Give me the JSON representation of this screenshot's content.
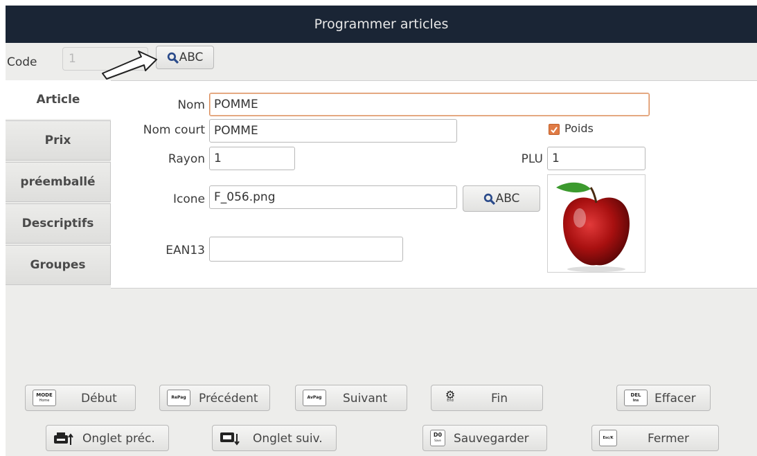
{
  "window": {
    "title": "Programmer articles"
  },
  "code": {
    "label": "Code",
    "value": "1",
    "search_label": "ABC"
  },
  "tabs": [
    {
      "label": "Article",
      "active": true
    },
    {
      "label": "Prix"
    },
    {
      "label": "préemballé"
    },
    {
      "label": "Descriptifs"
    },
    {
      "label": "Groupes"
    }
  ],
  "form": {
    "nom_label": "Nom",
    "nom_value": "POMME",
    "nom_court_label": "Nom court",
    "nom_court_value": "POMME",
    "poids_label": "Poids",
    "poids_checked": true,
    "rayon_label": "Rayon",
    "rayon_value": "1",
    "plu_label": "PLU",
    "plu_value": "1",
    "icone_label": "Icone",
    "icone_value": "F_056.png",
    "icone_search_label": "ABC",
    "ean13_label": "EAN13",
    "ean13_value": ""
  },
  "buttons": {
    "debut": {
      "label": "Début",
      "key_top": "MODE",
      "key_bottom": "Home"
    },
    "precedent": {
      "label": "Précédent",
      "key_top": "RePag"
    },
    "suivant": {
      "label": "Suivant",
      "key_top": "AvPag"
    },
    "fin": {
      "label": "Fin",
      "key_bottom": "End"
    },
    "effacer": {
      "label": "Effacer",
      "key_top": "DEL",
      "key_bottom": "Ins"
    },
    "onglet_prec": {
      "label": "Onglet préc."
    },
    "onglet_suiv": {
      "label": "Onglet suiv."
    },
    "sauvegarder": {
      "label": "Sauvegarder",
      "key_top": "D0",
      "key_bottom": "Save"
    },
    "fermer": {
      "label": "Fermer",
      "key_top": "Esc/K"
    }
  },
  "colors": {
    "titlebar": "#1a2535",
    "focus": "#d98b5a",
    "checkbox": "#e07b45"
  }
}
